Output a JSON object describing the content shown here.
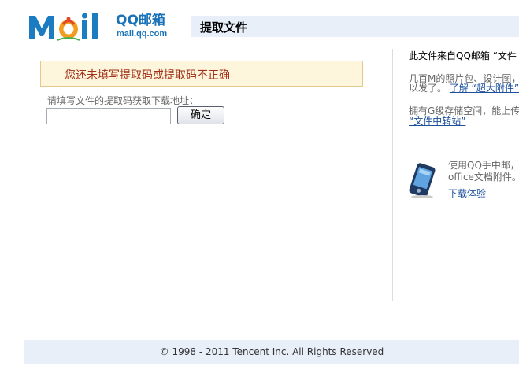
{
  "brand": {
    "logo_text": "Mail",
    "name": "QQ邮箱",
    "domain": "mail.qq.com"
  },
  "header": {
    "title": "提取文件"
  },
  "main": {
    "error_message": "您还未填写提取码或提取码不正确",
    "prompt_label": "请填写文件的提取码获取下载地址：",
    "code_input_value": "",
    "confirm_label": "确定"
  },
  "sidebar": {
    "title": "此文件来自QQ邮箱 “文件",
    "para1_line1": "几百M的照片包、设计图，",
    "para1_line2_text": "以发了。",
    "para1_link": "了解 “超大附件”",
    "para2_line1": "拥有G级存储空间，能上传",
    "para2_link": "“文件中转站”",
    "mobile_line1": "使用QQ手中邮，",
    "mobile_line2": "office文档附件。",
    "mobile_link": "下载体验"
  },
  "footer": {
    "copyright": "© 1998 - 2011 Tencent Inc. All Rights Reserved"
  },
  "colors": {
    "accent_blue": "#1a73b8",
    "error_text": "#a3311a",
    "error_bg": "#fdf6dc",
    "header_bg": "#e8eff9"
  }
}
